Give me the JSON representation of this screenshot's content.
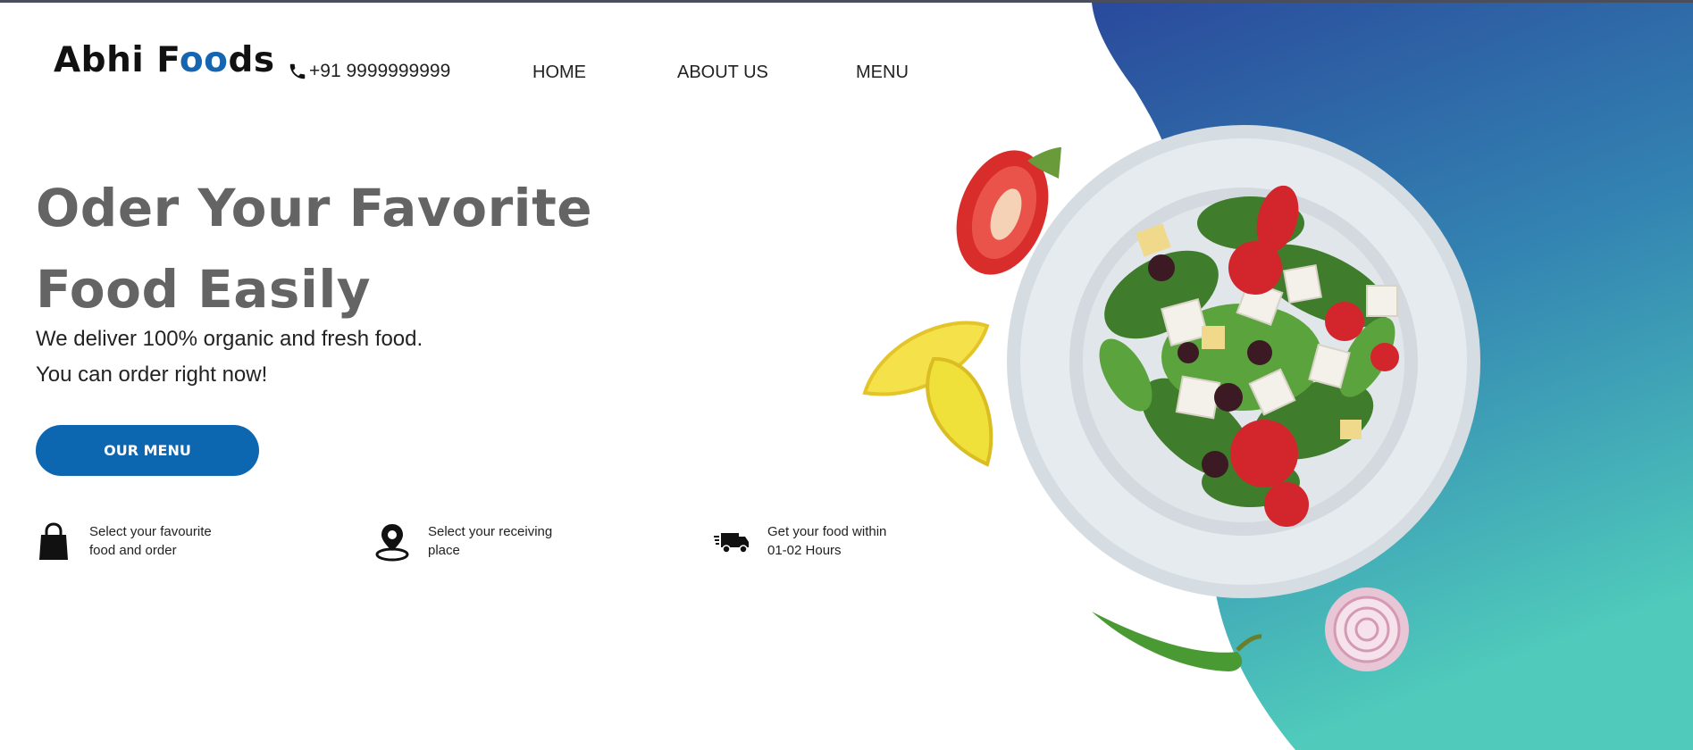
{
  "header": {
    "logo_prefix": "Abhi F",
    "logo_accent": "oo",
    "logo_suffix": "ds",
    "phone": "+91 9999999999"
  },
  "nav": {
    "items": [
      {
        "label": "HOME"
      },
      {
        "label": "ABOUT US"
      },
      {
        "label": "MENU"
      }
    ]
  },
  "hero": {
    "headline_line1": "Oder Your Favorite",
    "headline_line2": "Food Easily",
    "sub_line1": "We deliver 100% organic and fresh food.",
    "sub_line2": "You can order right now!",
    "cta_label": "OUR MENU"
  },
  "features": [
    {
      "line1": "Select your favourite",
      "line2": "food and order",
      "icon": "shopping-bag-icon"
    },
    {
      "line1": "Select your receiving",
      "line2": "place",
      "icon": "location-pin-icon"
    },
    {
      "line1": "Get your food within",
      "line2": "01-02 Hours",
      "icon": "delivery-truck-icon"
    }
  ],
  "colors": {
    "accent": "#0d66b0",
    "gradient_top": "#2a4a9c",
    "gradient_bottom": "#4fcabb",
    "headline": "#646464"
  }
}
